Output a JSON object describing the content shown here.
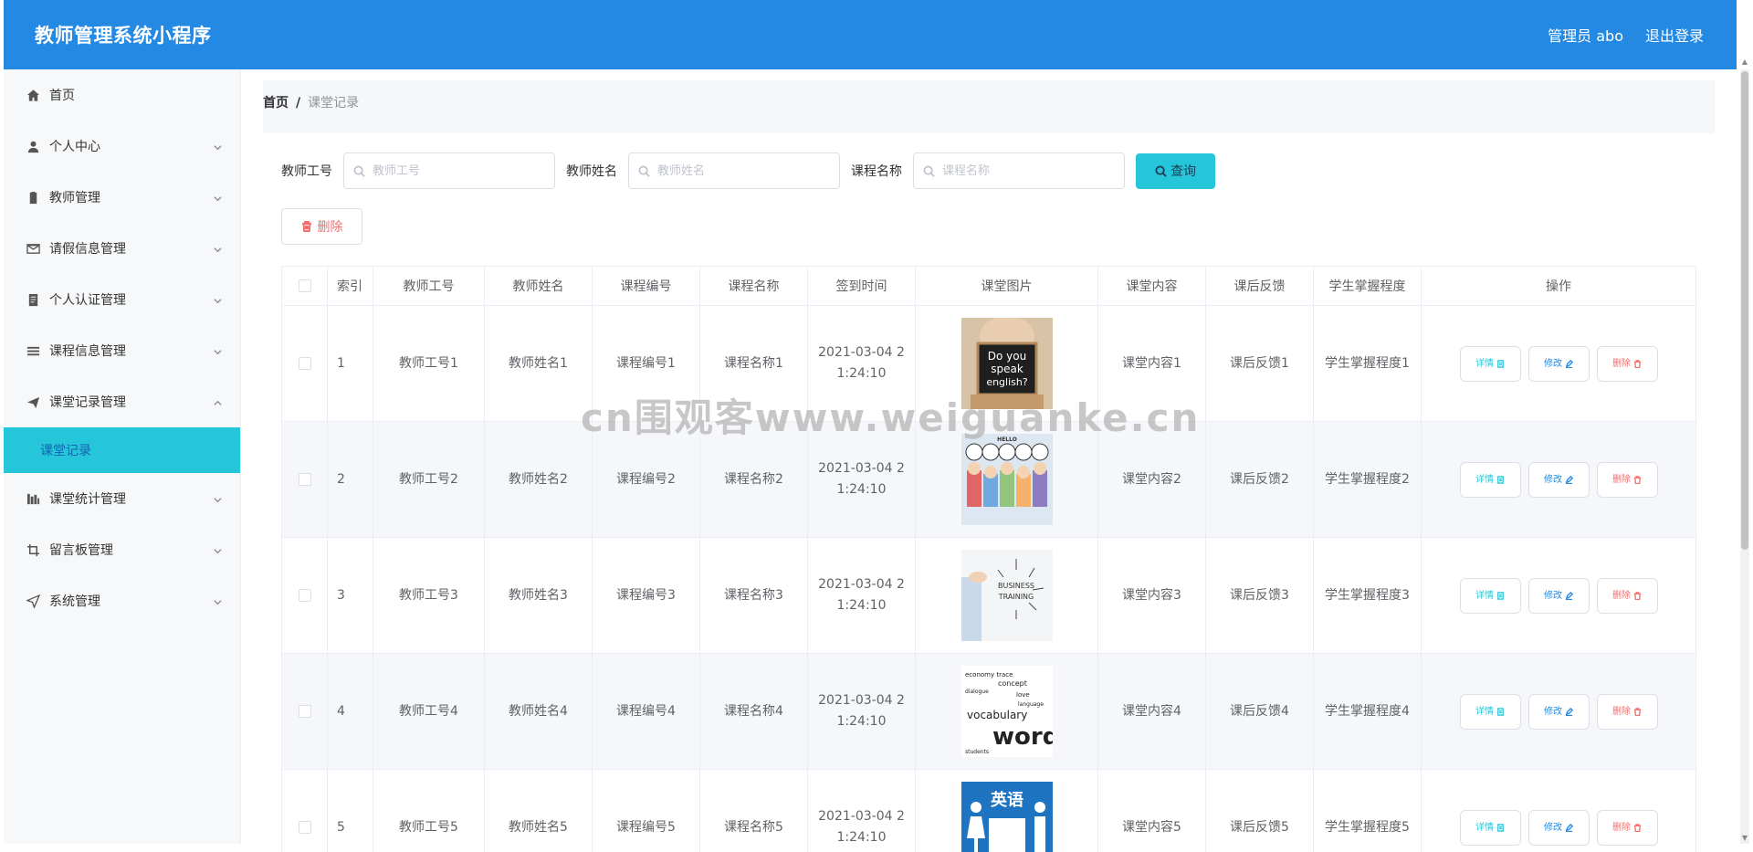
{
  "header": {
    "title": "教师管理系统小程序",
    "user": "管理员 abo",
    "logout": "退出登录"
  },
  "sidebar": {
    "items": [
      {
        "label": "首页",
        "icon": "home-icon",
        "expandable": false
      },
      {
        "label": "个人中心",
        "icon": "user-icon",
        "expandable": true
      },
      {
        "label": "教师管理",
        "icon": "clipboard-icon",
        "expandable": true
      },
      {
        "label": "请假信息管理",
        "icon": "mail-icon",
        "expandable": true
      },
      {
        "label": "个人认证管理",
        "icon": "badge-icon",
        "expandable": true
      },
      {
        "label": "课程信息管理",
        "icon": "list-icon",
        "expandable": true
      },
      {
        "label": "课堂记录管理",
        "icon": "send-icon",
        "expandable": true,
        "expanded": true
      },
      {
        "label": "课堂统计管理",
        "icon": "chart-icon",
        "expandable": true
      },
      {
        "label": "留言板管理",
        "icon": "crop-icon",
        "expandable": true
      },
      {
        "label": "系统管理",
        "icon": "navigation-icon",
        "expandable": true
      }
    ],
    "active_sub": "课堂记录"
  },
  "breadcrumb": {
    "home": "首页",
    "separator": "/",
    "current": "课堂记录"
  },
  "search": {
    "fields": [
      {
        "label": "教师工号",
        "placeholder": "教师工号",
        "value": ""
      },
      {
        "label": "教师姓名",
        "placeholder": "教师姓名",
        "value": ""
      },
      {
        "label": "课程名称",
        "placeholder": "课程名称",
        "value": ""
      }
    ],
    "query_label": "查询"
  },
  "toolbar": {
    "delete_label": "删除"
  },
  "table": {
    "columns": [
      "",
      "索引",
      "教师工号",
      "教师姓名",
      "课程编号",
      "课程名称",
      "签到时间",
      "课堂图片",
      "课堂内容",
      "课后反馈",
      "学生掌握程度",
      "操作"
    ],
    "rows": [
      {
        "index": "1",
        "teacher_no": "教师工号1",
        "teacher_name": "教师姓名1",
        "course_no": "课程编号1",
        "course_name": "课程名称1",
        "time_1": "2021-03-04 2",
        "time_2": "1:24:10",
        "image": "do-you-speak-english-image",
        "content": "课堂内容1",
        "feedback": "课后反馈1",
        "mastery": "学生掌握程度1"
      },
      {
        "index": "2",
        "teacher_no": "教师工号2",
        "teacher_name": "教师姓名2",
        "course_no": "课程编号2",
        "course_name": "课程名称2",
        "time_1": "2021-03-04 2",
        "time_2": "1:24:10",
        "image": "hello-kids-image",
        "content": "课堂内容2",
        "feedback": "课后反馈2",
        "mastery": "学生掌握程度2"
      },
      {
        "index": "3",
        "teacher_no": "教师工号3",
        "teacher_name": "教师姓名3",
        "course_no": "课程编号3",
        "course_name": "课程名称3",
        "time_1": "2021-03-04 2",
        "time_2": "1:24:10",
        "image": "business-training-image",
        "content": "课堂内容3",
        "feedback": "课后反馈3",
        "mastery": "学生掌握程度3"
      },
      {
        "index": "4",
        "teacher_no": "教师工号4",
        "teacher_name": "教师姓名4",
        "course_no": "课程编号4",
        "course_name": "课程名称4",
        "time_1": "2021-03-04 2",
        "time_2": "1:24:10",
        "image": "vocabulary-words-image",
        "content": "课堂内容4",
        "feedback": "课后反馈4",
        "mastery": "学生掌握程度4"
      },
      {
        "index": "5",
        "teacher_no": "教师工号5",
        "teacher_name": "教师姓名5",
        "course_no": "课程编号5",
        "course_name": "课程名称5",
        "time_1": "2021-03-04 2",
        "time_2": "1:24:10",
        "image": "english-sign-image",
        "content": "课堂内容5",
        "feedback": "课后反馈5",
        "mastery": "学生掌握程度5"
      }
    ],
    "ops": {
      "detail": "详情",
      "edit": "修改",
      "delete": "删除"
    }
  },
  "images": {
    "img1_lines": [
      "Do you",
      "speak",
      "english?"
    ],
    "img2_text": "HELLO",
    "img3_lines": [
      "BUSINESS",
      "TRAINING"
    ],
    "img4_main": "words",
    "img4_sub": "vocabulary",
    "img5_text": "英语"
  },
  "watermark": "cn围观客www.weiguanke.cn",
  "colors": {
    "header": "#2389e3",
    "accent": "#25c6d9",
    "danger": "#f56c6c"
  }
}
